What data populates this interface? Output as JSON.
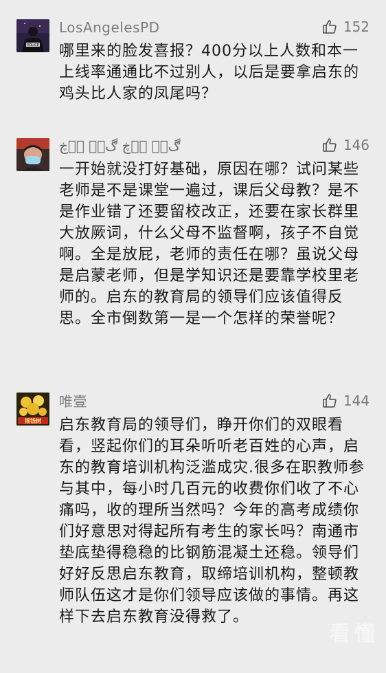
{
  "comments": [
    {
      "username": "LosAngelesPD",
      "likes": "152",
      "avatar_icon": "police-officer-avatar",
      "avatar_badge": "POLICE",
      "text": "哪里来的脸发喜报？400分以上人数和本一上线率通通比不过别人，以后是要拿启东的鸡头比人家的凤尾吗？"
    },
    {
      "username": "ڰۣۖ ۣۖڿ ڰۣۖ ۣۖڿ",
      "likes": "146",
      "avatar_icon": "masked-person-avatar",
      "text": "一开始就没打好基础，原因在哪？试问某些老师是不是课堂一遍过，课后父母教？是不是作业错了还要留校改正，还要在家长群里大放厥词，什么父母不监督啊，孩子不自觉啊。全是放屁，老师的责任在哪？虽说父母是启蒙老师，但是学知识还是要靠学校里老师的。启东的教育局的领导们应该值得反思。全市倒数第一是一个怎样的荣誉呢？"
    },
    {
      "username": "唯壹",
      "likes": "144",
      "avatar_icon": "gold-coins-avatar",
      "avatar_badge": "摇钱树",
      "text": "启东教育局的领导们，睁开你们的双眼看看，竖起你们的耳朵听听老百姓的心声，启东的教育培训机构泛滥成灾.很多在职教师参与其中，每小时几百元的收费你们收了不心痛吗，收的理所当然吗？今年的高考成绩你们好意思对得起所有考生的家长吗？南通市垫底垫得稳稳的比钢筋混凝土还稳。领导们好好反思启东教育，取缔培训机构，整顿教师队伍这才是你们领导应该做的事情。再这样下去启东教育没得救了。"
    }
  ],
  "like_icon": "thumbs-up-icon",
  "watermark": "看懂"
}
